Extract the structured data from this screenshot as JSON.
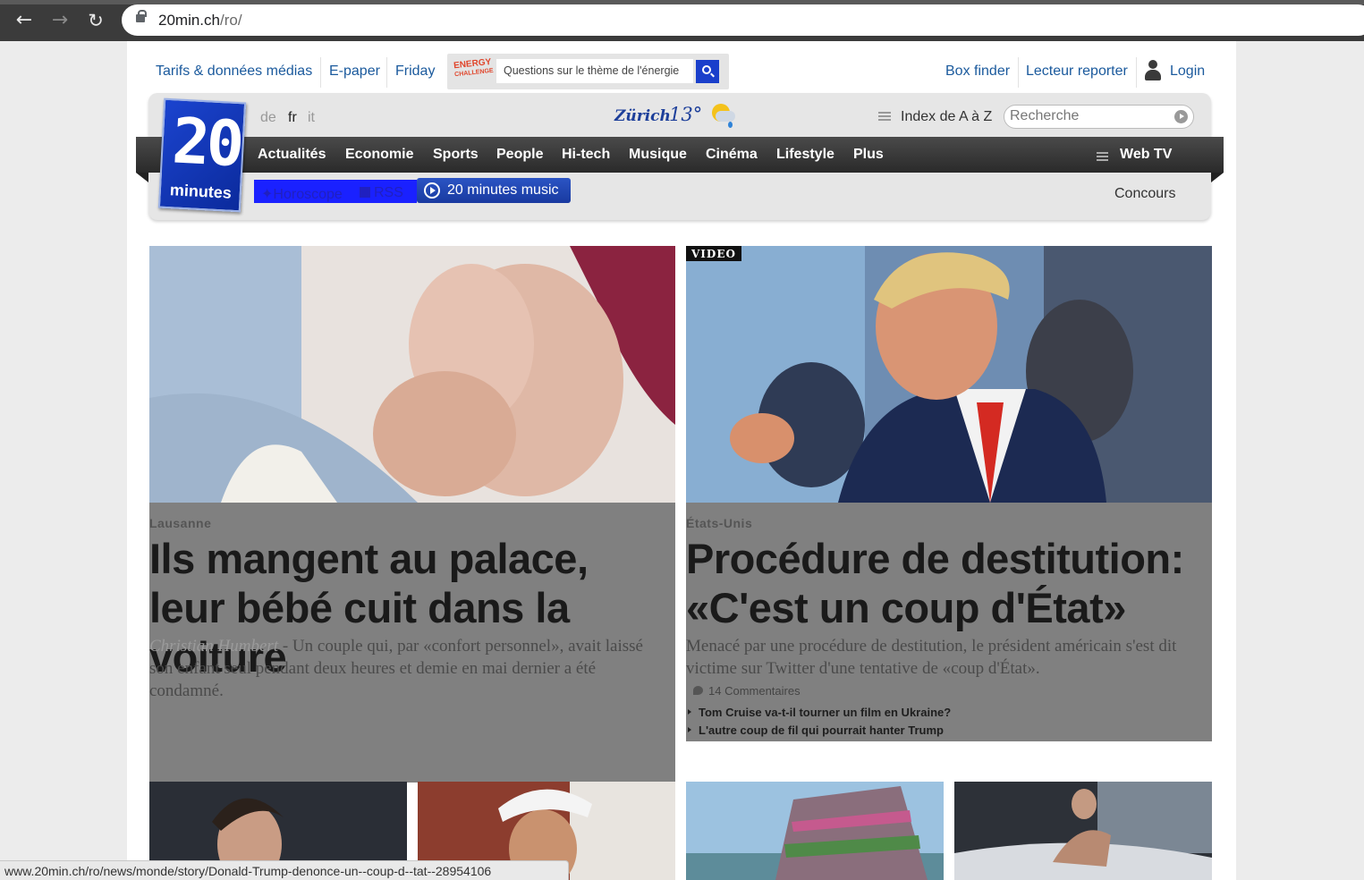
{
  "browser": {
    "url_host": "20min.ch",
    "url_path": "/ro/",
    "status_url": "www.20min.ch/ro/news/monde/story/Donald-Trump-denonce-un--coup-d--tat--28954106"
  },
  "toplinks": {
    "tarifs": "Tarifs & données médias",
    "epaper": "E-paper",
    "friday": "Friday",
    "box_finder": "Box finder",
    "lecteur_reporter": "Lecteur reporter",
    "login": "Login"
  },
  "energy": {
    "logo_line1": "ENERGY",
    "logo_line2": "CHALLENGE",
    "placeholder": "Questions sur le thème de l'énergie"
  },
  "header": {
    "langs": [
      "de",
      "fr",
      "it"
    ],
    "city": "Zürich",
    "temp": "13°",
    "index": "Index de A à Z",
    "search_placeholder": "Recherche"
  },
  "logo": {
    "number": "20",
    "word": "minutes"
  },
  "nav": {
    "items": [
      "Actualités",
      "Economie",
      "Sports",
      "People",
      "Hi-tech",
      "Musique",
      "Cinéma",
      "Lifestyle",
      "Plus"
    ],
    "webtv": "Web TV"
  },
  "subnav": {
    "horoscope": "Horoscope",
    "rss": "RSS",
    "music": "20 minutes music",
    "concours": "Concours"
  },
  "articles": [
    {
      "kicker": "Lausanne",
      "headline": "Ils mangent au palace, leur bébé cuit dans la voiture",
      "author": "Christian Humbert",
      "lead": " - Un couple qui, par «confort personnel», avait laissé son enfant seul pendant deux heures et demie en mai dernier a été condamné."
    },
    {
      "badge": "VIDEO",
      "kicker": "États-Unis",
      "headline": "Procédure de destitution: «C'est un coup d'État»",
      "lead": "Menacé par une procédure de destitution, le président américain s'est dit victime sur Twitter d'une tentative de «coup d'État».",
      "comments": "14 Commentaires",
      "related": [
        "Tom Cruise va-t-il tourner un film en Ukraine?",
        "L'autre coup de fil qui pourrait hanter Trump"
      ]
    }
  ],
  "colors": {
    "brand_blue": "#1b44cf",
    "link_blue": "#1b5a9d",
    "card_gray": "#808080"
  }
}
